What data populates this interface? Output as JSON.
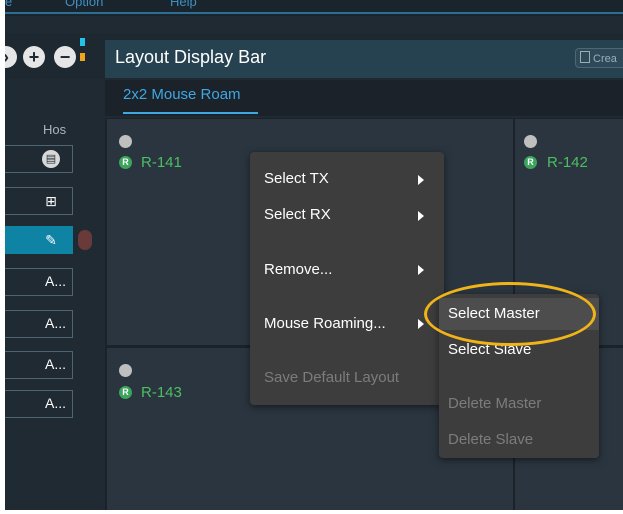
{
  "menubar": {
    "items": [
      "e",
      "Option",
      "Help"
    ]
  },
  "toolbar": {
    "add_label": "+",
    "remove_label": "−",
    "chevron_label": "›"
  },
  "panel": {
    "title": "Layout Display Bar",
    "create_label": "Crea"
  },
  "tabs": [
    {
      "label": "2x2 Mouse Roam"
    }
  ],
  "left_panel": {
    "header": "Hos",
    "rows": [
      {
        "label": "",
        "icon": "document-icon"
      },
      {
        "label": "",
        "icon": "grid-add-icon"
      },
      {
        "label": "",
        "icon": "edit-icon",
        "selected": true
      },
      {
        "label": "A..."
      },
      {
        "label": "A..."
      },
      {
        "label": "A..."
      },
      {
        "label": "A..."
      }
    ]
  },
  "cells": [
    {
      "name": "R-141",
      "badge": "R"
    },
    {
      "name": "R-142",
      "badge": "R"
    },
    {
      "name": "R-143",
      "badge": "R"
    }
  ],
  "context_menu": {
    "items": [
      {
        "label": "Select TX",
        "submenu": true,
        "enabled": true
      },
      {
        "label": "Select RX",
        "submenu": true,
        "enabled": true
      },
      {
        "label": "Remove...",
        "submenu": true,
        "enabled": true
      },
      {
        "label": "Mouse Roaming...",
        "submenu": true,
        "enabled": true
      },
      {
        "label": "Save Default Layout",
        "submenu": false,
        "enabled": false
      }
    ]
  },
  "submenu": {
    "items": [
      {
        "label": "Select Master",
        "enabled": true,
        "highlighted": true
      },
      {
        "label": "Select Slave",
        "enabled": true
      },
      {
        "label": "Delete Master",
        "enabled": false
      },
      {
        "label": "Delete Slave",
        "enabled": false
      }
    ]
  },
  "colors": {
    "accent": "#3fa7e2",
    "highlight_ring": "#f0b31a",
    "receiver_green": "#4cbf62"
  }
}
